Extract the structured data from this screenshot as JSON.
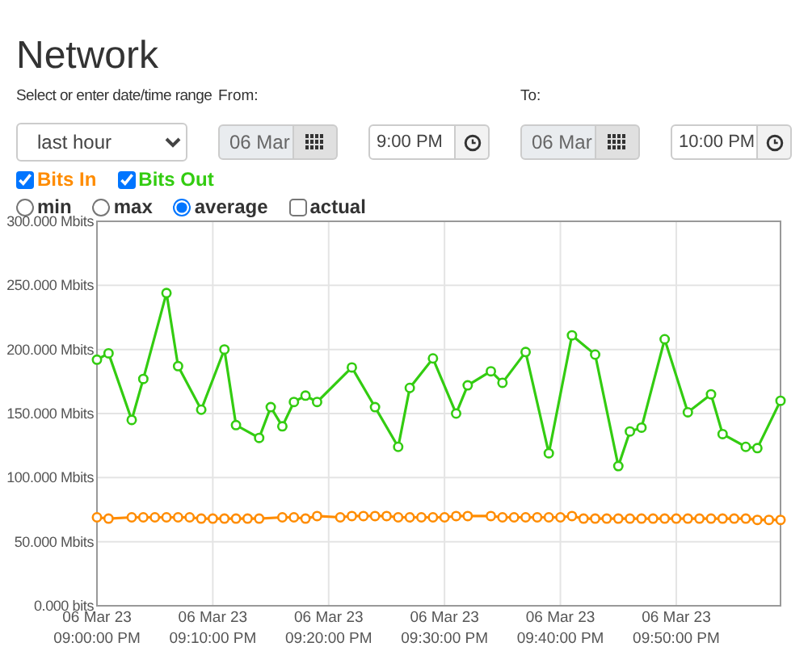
{
  "title": "Network",
  "range": {
    "label": "Select or enter date/time range",
    "value": "last hour"
  },
  "from": {
    "label": "From:",
    "date": "06 Mar",
    "time": "9:00 PM"
  },
  "to": {
    "label": "To:",
    "date": "06 Mar",
    "time": "10:00 PM"
  },
  "series_toggles": [
    {
      "checked": true
    },
    {
      "checked": true
    }
  ],
  "modes": [
    {
      "kind": "radio",
      "label": "min",
      "selected": false
    },
    {
      "kind": "radio",
      "label": "max",
      "selected": false
    },
    {
      "kind": "radio",
      "label": "average",
      "selected": true
    },
    {
      "kind": "checkbox",
      "label": "actual",
      "selected": false
    }
  ],
  "chart_data": {
    "type": "line",
    "grid": true,
    "ylim": [
      0,
      300
    ],
    "yticks": [
      {
        "value": 0,
        "label": "0.000 bits"
      },
      {
        "value": 50,
        "label": "50.000 Mbits"
      },
      {
        "value": 100,
        "label": "100.000 Mbits"
      },
      {
        "value": 150,
        "label": "150.000 Mbits"
      },
      {
        "value": 200,
        "label": "200.000 Mbits"
      },
      {
        "value": 250,
        "label": "250.000 Mbits"
      },
      {
        "value": 300,
        "label": "300.000 Mbits"
      }
    ],
    "categories": [
      "06 Mar 23\n09:00:00 PM",
      null,
      null,
      null,
      null,
      null,
      null,
      null,
      null,
      null,
      "06 Mar 23\n09:10:00 PM",
      null,
      null,
      null,
      null,
      null,
      null,
      null,
      null,
      null,
      "06 Mar 23\n09:20:00 PM",
      null,
      null,
      null,
      null,
      null,
      null,
      null,
      null,
      null,
      "06 Mar 23\n09:30:00 PM",
      null,
      null,
      null,
      null,
      null,
      null,
      null,
      null,
      null,
      "06 Mar 23\n09:40:00 PM",
      null,
      null,
      null,
      null,
      null,
      null,
      null,
      null,
      null,
      "06 Mar 23\n09:50:00 PM",
      null,
      null,
      null,
      null,
      null,
      null,
      null,
      null,
      null
    ],
    "series": [
      {
        "name": "Bits In",
        "color": "#ff8c00",
        "marker": "circle",
        "values": [
          69,
          68,
          null,
          69,
          69,
          69,
          69,
          69,
          69,
          68,
          68,
          68,
          68,
          68,
          68,
          null,
          69,
          69,
          68,
          70,
          null,
          69,
          70,
          70,
          70,
          70,
          69,
          69,
          69,
          69,
          69,
          70,
          70,
          null,
          70,
          69,
          69,
          69,
          69,
          69,
          69,
          70,
          68,
          68,
          68,
          68,
          68,
          68,
          68,
          68,
          68,
          68,
          68,
          68,
          68,
          68,
          68,
          67,
          67,
          67
        ]
      },
      {
        "name": "Bits Out",
        "color": "#33cc11",
        "marker": "circle",
        "values": [
          192,
          197,
          null,
          145,
          177,
          null,
          244,
          187,
          null,
          153,
          null,
          200,
          141,
          null,
          131,
          155,
          140,
          159,
          164,
          159,
          null,
          null,
          186,
          null,
          155,
          null,
          124,
          170,
          null,
          193,
          null,
          150,
          172,
          null,
          183,
          174,
          null,
          198,
          null,
          119,
          null,
          211,
          null,
          196,
          null,
          109,
          136,
          139,
          null,
          208,
          null,
          151,
          null,
          165,
          134,
          null,
          124,
          123,
          null,
          160
        ]
      }
    ]
  }
}
